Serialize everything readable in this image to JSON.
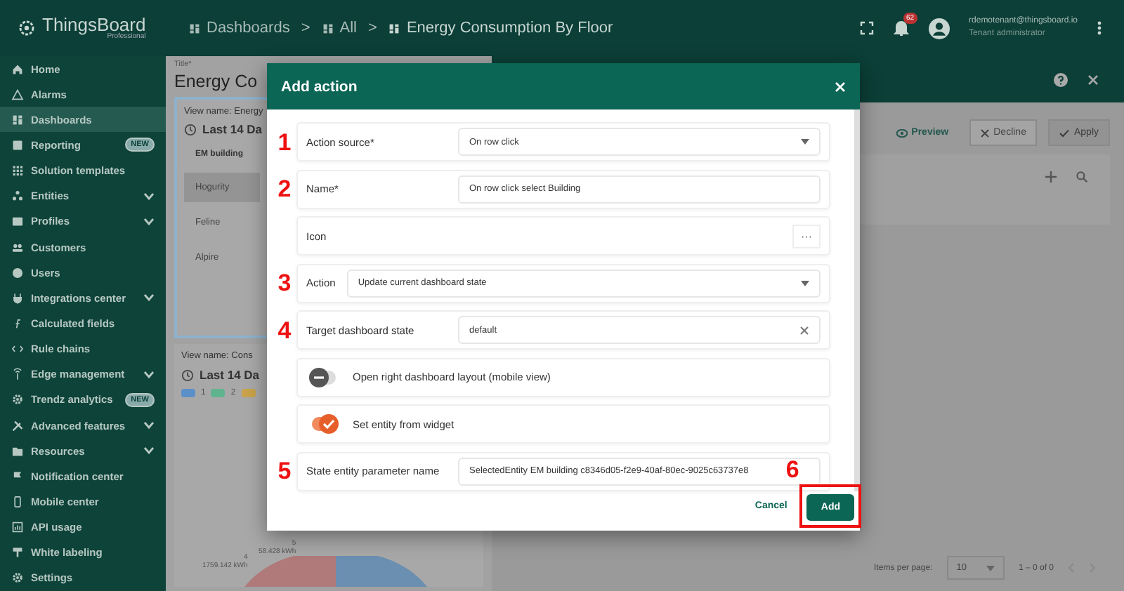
{
  "topbar": {
    "logo": "ThingsBoard",
    "logo_sub": "Professional",
    "breadcrumbs": [
      "Dashboards",
      "All",
      "Energy Consumption By Floor"
    ],
    "separator": ">",
    "notification_count": "62",
    "user_email": "rdemotenant@thingsboard.io",
    "user_role": "Tenant administrator"
  },
  "sidebar": {
    "items": [
      {
        "label": "Home",
        "selected": false
      },
      {
        "label": "Alarms",
        "selected": false
      },
      {
        "label": "Dashboards",
        "selected": true
      },
      {
        "label": "Reporting",
        "selected": false,
        "badge": "NEW"
      },
      {
        "label": "Solution templates",
        "selected": false
      },
      {
        "label": "Entities",
        "selected": false,
        "expandable": true
      },
      {
        "label": "Profiles",
        "selected": false,
        "expandable": true
      },
      {
        "label": "Customers",
        "selected": false
      },
      {
        "label": "Users",
        "selected": false
      },
      {
        "label": "Integrations center",
        "selected": false,
        "expandable": true
      },
      {
        "label": "Calculated fields",
        "selected": false
      },
      {
        "label": "Rule chains",
        "selected": false
      },
      {
        "label": "Edge management",
        "selected": false,
        "expandable": true
      },
      {
        "label": "Trendz analytics",
        "selected": false,
        "badge": "NEW"
      },
      {
        "label": "Advanced features",
        "selected": false,
        "expandable": true
      },
      {
        "label": "Resources",
        "selected": false,
        "expandable": true
      },
      {
        "label": "Notification center",
        "selected": false
      },
      {
        "label": "Mobile center",
        "selected": false
      },
      {
        "label": "API usage",
        "selected": false
      },
      {
        "label": "White labeling",
        "selected": false
      },
      {
        "label": "Settings",
        "selected": false
      }
    ]
  },
  "editor": {
    "title_label": "Title*",
    "title_value": "Energy Co",
    "widget_table": {
      "view_name": "View name: Energy",
      "timewindow": "Last 14 Da",
      "column": "EM building",
      "rows": [
        {
          "cell": "Hogurity",
          "selected": true
        },
        {
          "cell": "Feline",
          "selected": false
        },
        {
          "cell": "Alpire",
          "selected": false
        }
      ]
    },
    "widget_chart": {
      "view_name": "View name: Cons",
      "timewindow": "Last 14 Da",
      "legend": [
        {
          "label": "1",
          "color": "#5b8fc7"
        },
        {
          "label": "2",
          "color": "#5fb48f"
        },
        {
          "color": "#c9a24a"
        }
      ],
      "slice_labels": [
        {
          "index": "5",
          "value": "58.428 kWh"
        },
        {
          "index": "4",
          "value": "1759.142 kWh"
        }
      ]
    }
  },
  "panel": {
    "actions": [
      "Preview",
      "Decline",
      "Apply"
    ],
    "items_per_page_label": "Items per page:",
    "items_per_page": "10",
    "range": "1 – 0 of 0"
  },
  "dialog": {
    "title": "Add action",
    "rows": [
      {
        "kind": "select",
        "marker": "1",
        "label": "Action source*",
        "value": "On row click"
      },
      {
        "kind": "input",
        "marker": "2",
        "label": "Name*",
        "value": "On row click select Building"
      },
      {
        "kind": "icon",
        "label": "Icon",
        "more": "···"
      },
      {
        "kind": "select",
        "marker": "3",
        "label": "Action",
        "value": "Update current dashboard state"
      },
      {
        "kind": "clearable",
        "marker": "4",
        "label": "Target dashboard state",
        "value": "default"
      },
      {
        "kind": "toggle",
        "label": "Open right dashboard layout (mobile view)",
        "on": false
      },
      {
        "kind": "toggle",
        "label": "Set entity from widget",
        "on": true
      },
      {
        "kind": "input",
        "marker": "5",
        "label": "State entity parameter name",
        "value": "SelectedEntity EM building c8346d05-f2e9-40af-80ec-9025c63737e8"
      }
    ],
    "cancel": "Cancel",
    "add": "Add",
    "add_marker": "6"
  }
}
